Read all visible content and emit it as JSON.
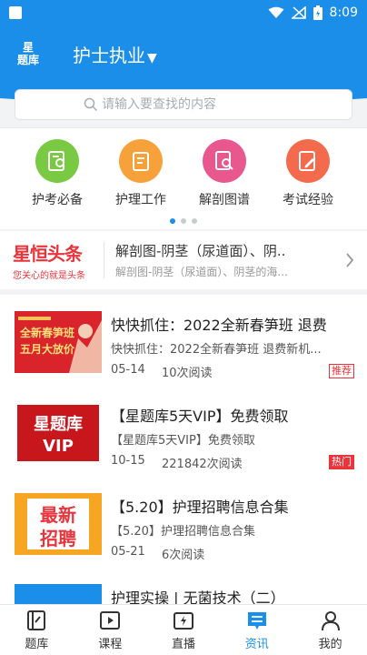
{
  "status_bar": {
    "time": "8:09"
  },
  "app_bar": {
    "logo_text_line1": "星",
    "logo_text_line2": "题库",
    "exam_selector": "护士执业",
    "caret": "▼"
  },
  "search": {
    "placeholder": "请输入要查找的内容"
  },
  "categories": [
    {
      "label": "护考必备",
      "color": "#7ac943",
      "icon": "user-card-icon"
    },
    {
      "label": "护理工作",
      "color": "#f7a13b",
      "icon": "clipboard-icon"
    },
    {
      "label": "解剖图谱",
      "color": "#e9578f",
      "icon": "document-search-icon"
    },
    {
      "label": "考试经验",
      "color": "#f36a4c",
      "icon": "pen-doc-icon"
    }
  ],
  "headline": {
    "brand_title": "星恒头条",
    "brand_sub": "您关心的就是头条",
    "main_text": "解剖图-阴茎（尿道面）、阴..",
    "sub_text": "解剖图-阴茎（尿道面）、阴茎的海..."
  },
  "news": [
    {
      "title": "快快抓住：2022全新春笋班 退费",
      "subtitle": "快快抓住：2022全新春笋班 退费新机...",
      "date": "05-14",
      "views": "10次阅读",
      "tag": "推荐",
      "thumb_text1": "全新春笋班",
      "thumb_text2": "五月大放价"
    },
    {
      "title": "【星题库5天VIP】免费领取",
      "subtitle": "【星题库5天VIP】免费领取",
      "date": "10-15",
      "views": "221842次阅读",
      "tag": "热门",
      "thumb_text1": "星题库",
      "thumb_text2": "VIP"
    },
    {
      "title": "【5.20】护理招聘信息合集",
      "subtitle": "【5.20】护理招聘信息合集",
      "date": "05-21",
      "views": "6次阅读",
      "tag": "",
      "thumb_text1": "最新",
      "thumb_text2": "招聘"
    },
    {
      "title": "护理实操 | 无菌技术（二）",
      "subtitle": "",
      "date": "",
      "views": "",
      "tag": ""
    }
  ],
  "tabs": [
    {
      "label": "题库",
      "icon": "book-icon",
      "active": false
    },
    {
      "label": "课程",
      "icon": "play-icon",
      "active": false
    },
    {
      "label": "直播",
      "icon": "live-icon",
      "active": false
    },
    {
      "label": "资讯",
      "icon": "news-icon",
      "active": true
    },
    {
      "label": "我的",
      "icon": "profile-icon",
      "active": false
    }
  ],
  "colors": {
    "primary": "#1a8ee8",
    "red": "#e8343a"
  }
}
